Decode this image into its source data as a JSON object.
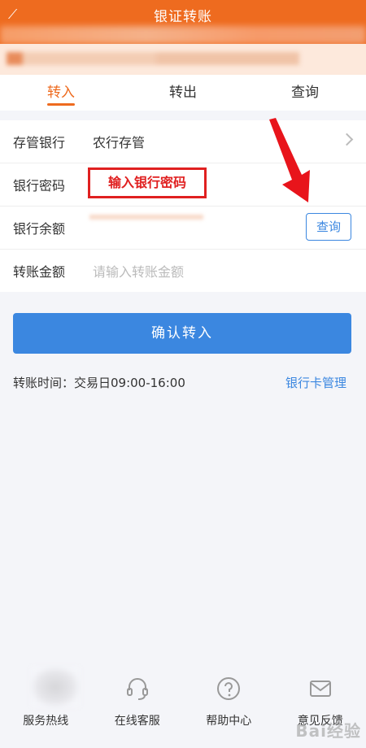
{
  "header": {
    "title": "银证转账"
  },
  "tabs": [
    {
      "label": "转入",
      "active": true
    },
    {
      "label": "转出",
      "active": false
    },
    {
      "label": "查询",
      "active": false
    }
  ],
  "form": {
    "bank_label": "存管银行",
    "bank_value": "农行存管",
    "password_label": "银行密码",
    "password_annotation": "输入银行密码",
    "balance_label": "银行余额",
    "query_button": "查询",
    "amount_label": "转账金额",
    "amount_placeholder": "请输入转账金额"
  },
  "confirm_button": "确认转入",
  "transfer_time": "转账时间：交易日09:00-16:00",
  "card_management": "银行卡管理",
  "footer": [
    {
      "label": "服务热线",
      "icon": "hotline-icon"
    },
    {
      "label": "在线客服",
      "icon": "headset-icon"
    },
    {
      "label": "帮助中心",
      "icon": "question-icon"
    },
    {
      "label": "意见反馈",
      "icon": "mail-icon"
    }
  ],
  "watermark": "Bai经验",
  "colors": {
    "brand": "#ee6b1f",
    "link": "#3b87e0",
    "annotation": "#e02020"
  }
}
